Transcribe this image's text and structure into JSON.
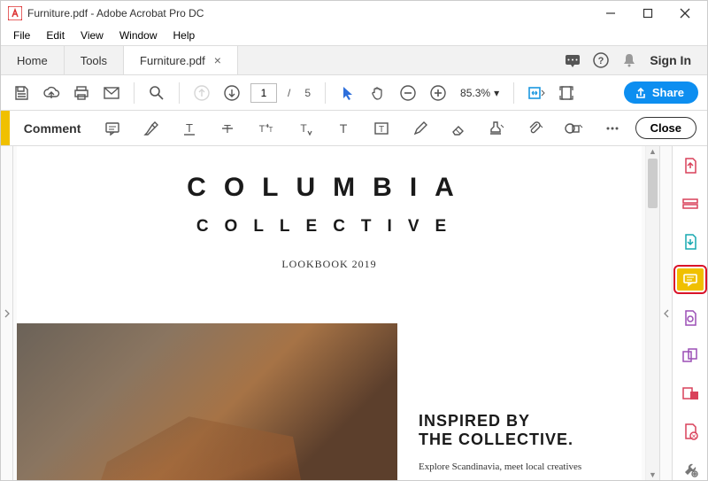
{
  "window": {
    "title": "Furniture.pdf - Adobe Acrobat Pro DC"
  },
  "menu": {
    "file": "File",
    "edit": "Edit",
    "view": "View",
    "window": "Window",
    "help": "Help"
  },
  "tabs": {
    "home": "Home",
    "tools": "Tools",
    "doc": "Furniture.pdf",
    "signin": "Sign In"
  },
  "toolbar": {
    "page_current": "1",
    "page_sep": "/",
    "page_total": "5",
    "zoom": "85.3%",
    "share": "Share"
  },
  "commentbar": {
    "label": "Comment",
    "close": "Close"
  },
  "document": {
    "h1": "COLUMBIA",
    "h2": "COLLECTIVE",
    "sub": "LOOKBOOK 2019",
    "heading_a": "INSPIRED BY",
    "heading_b": "THE COLLECTIVE.",
    "body": "Explore Scandinavia, meet local creatives"
  }
}
